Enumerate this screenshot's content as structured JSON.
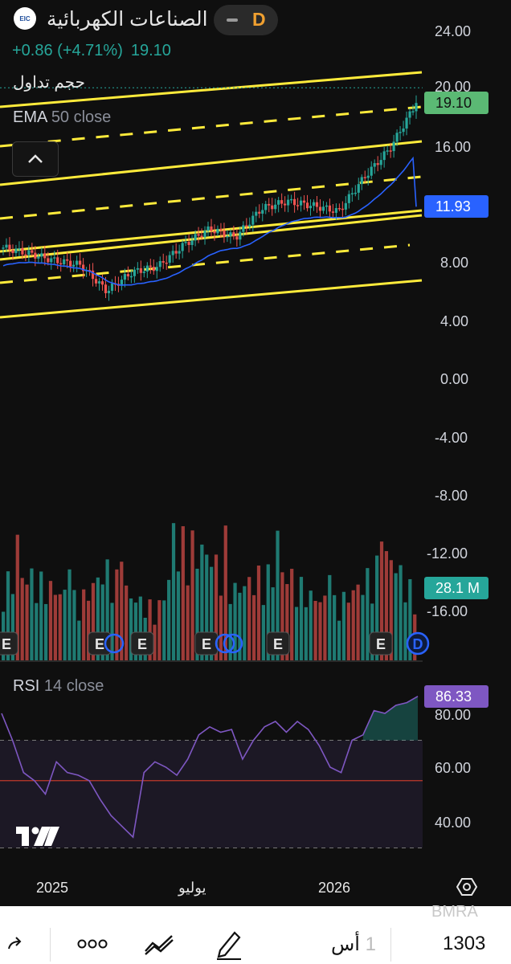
{
  "header": {
    "logo_text": "EIC",
    "title": "الصناعات الكهربائية",
    "interval": "D",
    "change": "+0.86 (+4.71%)",
    "price": "19.10"
  },
  "indicators": {
    "volume_label": "حجم تداول",
    "ema_name": "EMA",
    "ema_params": "50 close",
    "rsi_name": "RSI",
    "rsi_params": "14 close"
  },
  "price_axis": [
    "24.00",
    "20.00",
    "16.00",
    "8.00",
    "4.00",
    "0.00",
    "-4.00",
    "-8.00",
    "-12.00",
    "-16.00"
  ],
  "rsi_axis": [
    "80.00",
    "60.00",
    "40.00"
  ],
  "tags": {
    "price": "19.10",
    "ema": "11.93",
    "volume": "28.1 M",
    "rsi": "86.33"
  },
  "time_axis": [
    "2025",
    "يوليو",
    "2026"
  ],
  "earnings_marker": "E",
  "dividend_marker": "D",
  "bottom": {
    "symbol_watermark": "BMRA",
    "value": "1303",
    "timeframe_num": "1",
    "timeframe_unit": "أس"
  },
  "colors": {
    "up": "#26a69a",
    "down": "#ef5350",
    "ema": "#2962ff",
    "channel": "#ffeb3b",
    "rsi": "#7e57c2",
    "price_tag": "#3cb371",
    "ema_tag": "#2962ff",
    "volume_tag": "#26a69a"
  },
  "chart_data": [
    {
      "type": "candlestick",
      "title": "الصناعات الكهربائية",
      "ylim": [
        -18,
        25
      ],
      "x": [
        "2024-11",
        "2024-12",
        "2025-01",
        "2025-02",
        "2025-03",
        "2025-04",
        "2025-05",
        "2025-06",
        "2025-07",
        "2025-08",
        "2025-09",
        "2025-10",
        "2025-11",
        "2025-12",
        "2026-01",
        "2026-02",
        "2026-03"
      ],
      "close": [
        9.1,
        8.7,
        8.2,
        7.9,
        6.1,
        7.4,
        7.8,
        9.3,
        10.4,
        9.8,
        11.8,
        12.3,
        12.0,
        11.6,
        14.0,
        16.0,
        19.1
      ],
      "ema50_last": 11.93,
      "last_price": 19.1
    },
    {
      "type": "bar",
      "title": "حجم تداول",
      "last_value_label": "28.1 M",
      "relative_volume": [
        0.55,
        0.6,
        0.5,
        0.42,
        0.65,
        0.45,
        0.35,
        0.85,
        0.75,
        0.5,
        0.6,
        0.62,
        0.45,
        0.4,
        0.55,
        0.75,
        0.45
      ]
    },
    {
      "type": "line",
      "title": "RSI 14 close",
      "ylim": [
        30,
        90
      ],
      "upper_band": 70,
      "lower_band": 30,
      "mid_line": 55,
      "values": [
        80,
        70,
        58,
        55,
        50,
        62,
        58,
        57,
        55,
        48,
        42,
        38,
        34,
        58,
        62,
        60,
        57,
        63,
        72,
        75,
        73,
        74,
        63,
        70,
        75,
        77,
        73,
        77,
        74,
        68,
        60,
        58,
        70,
        72,
        81,
        80,
        83,
        84,
        86.33
      ],
      "last": 86.33
    }
  ]
}
